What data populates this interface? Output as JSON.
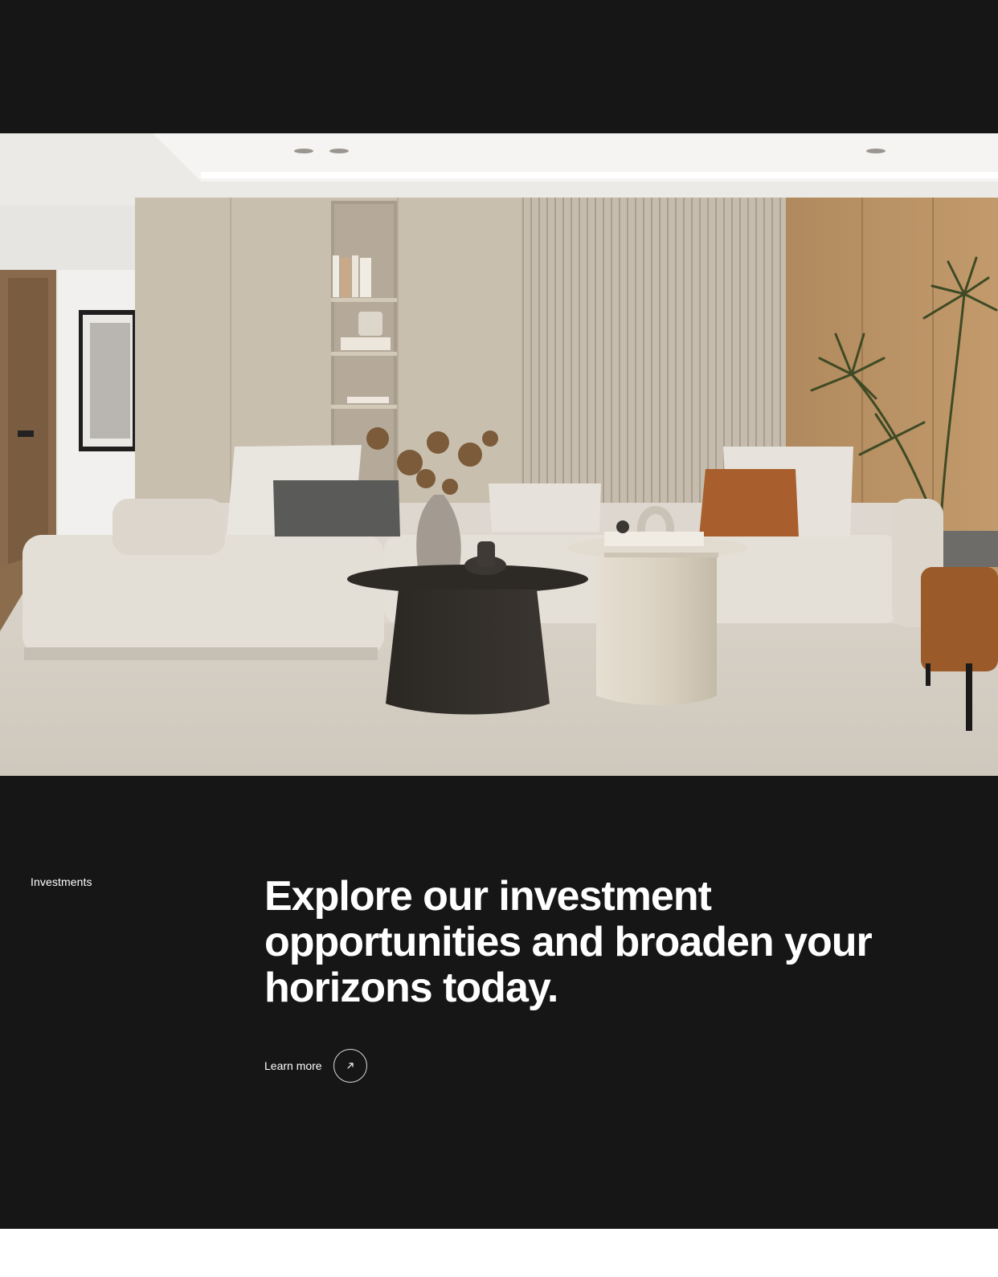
{
  "hero": {
    "image_name": "living-room-interior-photo"
  },
  "section": {
    "label": "Investments",
    "headline": "Explore our investment opportunities and broaden your horizons today.",
    "cta_label": "Learn more",
    "cta_icon": "arrow-up-right-icon"
  },
  "colors": {
    "background": "#161616",
    "text": "#ffffff",
    "circle_border": "#d9d9d9"
  }
}
